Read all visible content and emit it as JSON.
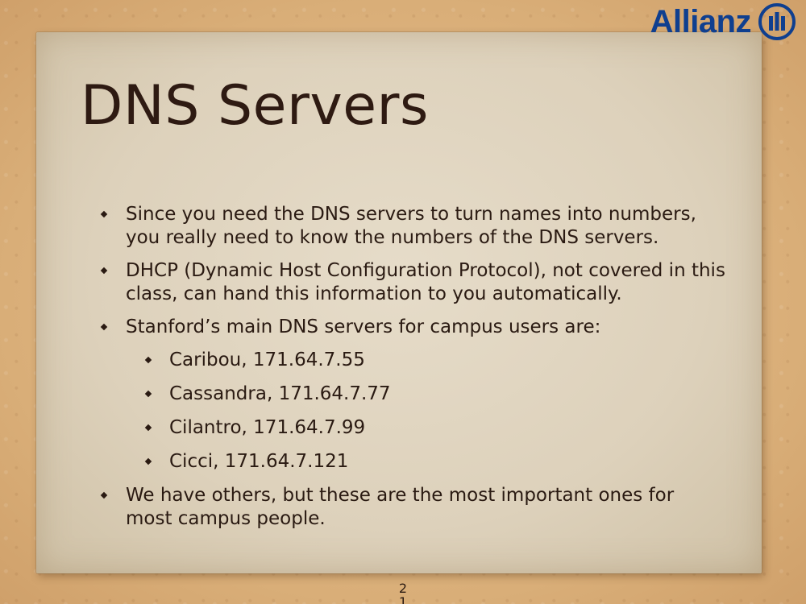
{
  "brand": {
    "name": "Allianz",
    "color": "#0f3f8f",
    "icon": "allianz-eagle-icon"
  },
  "slide": {
    "title": "DNS Servers",
    "page_number": "21",
    "bullets": [
      {
        "level": 1,
        "text": "Since you need the DNS servers to turn names into numbers, you really need to know the numbers of the DNS servers."
      },
      {
        "level": 1,
        "text": "DHCP (Dynamic Host Configuration Protocol), not covered in this class, can hand this information to you automatically."
      },
      {
        "level": 1,
        "text": "Stanford’s main DNS servers for campus users are:"
      },
      {
        "level": 2,
        "text": "Caribou, 171.64.7.55"
      },
      {
        "level": 2,
        "text": "Cassandra, 171.64.7.77"
      },
      {
        "level": 2,
        "text": "Cilantro, 171.64.7.99"
      },
      {
        "level": 2,
        "text": "Cicci, 171.64.7.121"
      },
      {
        "level": 1,
        "text": "We have others, but these are the most important ones for most campus people."
      }
    ]
  },
  "colors": {
    "text": "#2a1a12",
    "title": "#2e1a12",
    "paper": "#ddd1bb",
    "background": "#d9ae78"
  }
}
